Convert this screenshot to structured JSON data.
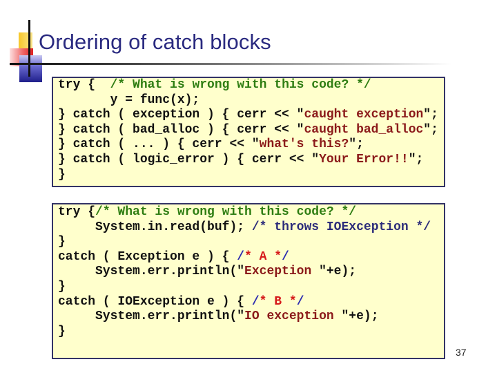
{
  "slide": {
    "title": "Ordering of catch blocks",
    "page_number": "37"
  },
  "colors": {
    "title": "#2a2a80",
    "code_background": "#ffffcc",
    "box_border": "#333366",
    "comment_green": "#2e7d12",
    "string_maroon": "#8b1a1a",
    "comment_navy": "#2c2c7a",
    "label_red": "#d61a1a"
  },
  "cpp_example": {
    "lines": [
      [
        {
          "t": "try {  ",
          "c": "plain"
        },
        {
          "t": "/* What is wrong with this code? */",
          "c": "green"
        }
      ],
      [
        {
          "t": "       y = func(x);",
          "c": "plain"
        }
      ],
      [
        {
          "t": "} catch ( exception ) { cerr << \"",
          "c": "plain"
        },
        {
          "t": "caught exception",
          "c": "str"
        },
        {
          "t": "\";",
          "c": "plain"
        }
      ],
      [
        {
          "t": "} catch ( bad_alloc ) { cerr << \"",
          "c": "plain"
        },
        {
          "t": "caught bad_alloc",
          "c": "str"
        },
        {
          "t": "\";",
          "c": "plain"
        }
      ],
      [
        {
          "t": "} catch ( ... ) { cerr << \"",
          "c": "plain"
        },
        {
          "t": "what's this?",
          "c": "str"
        },
        {
          "t": "\";",
          "c": "plain"
        }
      ],
      [
        {
          "t": "} catch ( logic_error ) { cerr << \"",
          "c": "plain"
        },
        {
          "t": "Your Error!!",
          "c": "str"
        },
        {
          "t": "\";",
          "c": "plain"
        }
      ],
      [
        {
          "t": "}",
          "c": "plain"
        }
      ]
    ]
  },
  "java_example": {
    "lines": [
      [
        {
          "t": "try {",
          "c": "plain"
        },
        {
          "t": "/* What is wrong with this code? */",
          "c": "green"
        }
      ],
      [
        {
          "t": "     System.in.read(buf); ",
          "c": "plain"
        },
        {
          "t": "/* throws IOException */",
          "c": "navy"
        }
      ],
      [
        {
          "t": "}",
          "c": "plain"
        }
      ],
      [
        {
          "t": "catch ( Exception e ) { ",
          "c": "plain"
        },
        {
          "t": "/",
          "c": "blue"
        },
        {
          "t": "* A *",
          "c": "red"
        },
        {
          "t": "/",
          "c": "blue"
        }
      ],
      [
        {
          "t": "     System.err.println(\"",
          "c": "plain"
        },
        {
          "t": "Exception ",
          "c": "str"
        },
        {
          "t": "\"+e);",
          "c": "plain"
        }
      ],
      [
        {
          "t": "}",
          "c": "plain"
        }
      ],
      [
        {
          "t": "catch ( IOException e ) { ",
          "c": "plain"
        },
        {
          "t": "/",
          "c": "blue"
        },
        {
          "t": "* B *",
          "c": "red"
        },
        {
          "t": "/",
          "c": "blue"
        }
      ],
      [
        {
          "t": "     System.err.println(\"",
          "c": "plain"
        },
        {
          "t": "IO exception ",
          "c": "str"
        },
        {
          "t": "\"+e);",
          "c": "plain"
        }
      ],
      [
        {
          "t": "}",
          "c": "plain"
        }
      ]
    ]
  }
}
